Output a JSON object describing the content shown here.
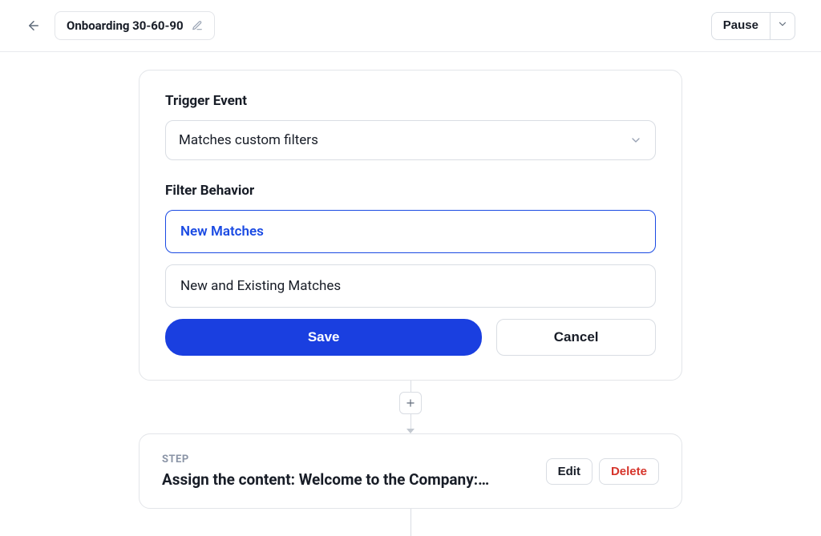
{
  "header": {
    "workflow_title": "Onboarding 30-60-90",
    "pause_label": "Pause"
  },
  "trigger_panel": {
    "trigger_label": "Trigger Event",
    "trigger_value": "Matches custom filters",
    "filter_label": "Filter Behavior",
    "options": {
      "new_matches": "New Matches",
      "new_and_existing": "New and Existing Matches"
    },
    "save_label": "Save",
    "cancel_label": "Cancel"
  },
  "step_card": {
    "kicker": "STEP",
    "title": "Assign the content: Welcome to the Company:…",
    "edit_label": "Edit",
    "delete_label": "Delete"
  }
}
